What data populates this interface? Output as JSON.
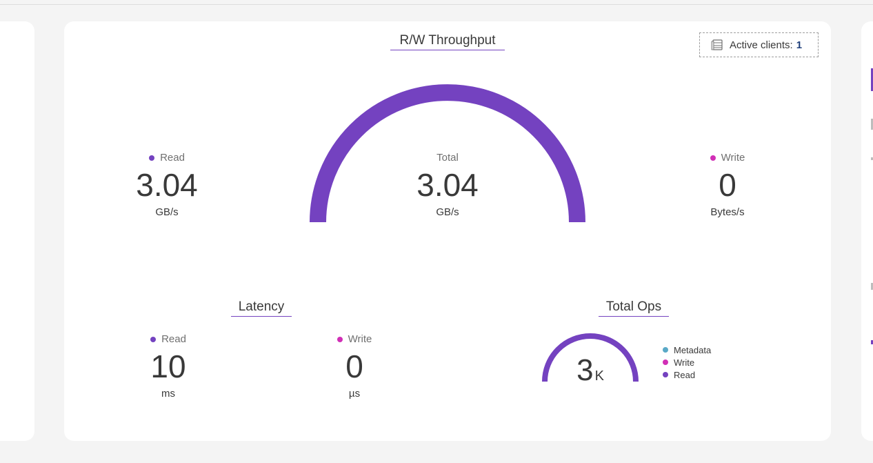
{
  "colors": {
    "accent": "#7442c0",
    "read": "#7442c0",
    "write": "#d12fb6",
    "metadata": "#5aa9c7"
  },
  "throughput": {
    "title": "R/W Throughput",
    "active_clients_label": "Active clients:",
    "active_clients_value": "1",
    "active_clients_icon": "server-stack-icon",
    "read": {
      "label": "Read",
      "value": "3.04",
      "unit": "GB/s"
    },
    "total": {
      "label": "Total",
      "value": "3.04",
      "unit": "GB/s"
    },
    "write": {
      "label": "Write",
      "value": "0",
      "unit": "Bytes/s"
    },
    "gauge_read_fraction": 1.0
  },
  "latency": {
    "title": "Latency",
    "read": {
      "label": "Read",
      "value": "10",
      "unit": "ms"
    },
    "write": {
      "label": "Write",
      "value": "0",
      "unit": "µs"
    }
  },
  "total_ops": {
    "title": "Total Ops",
    "value": "3",
    "suffix": "K",
    "read_fraction": 1.0,
    "legend": [
      "Metadata",
      "Write",
      "Read"
    ]
  }
}
